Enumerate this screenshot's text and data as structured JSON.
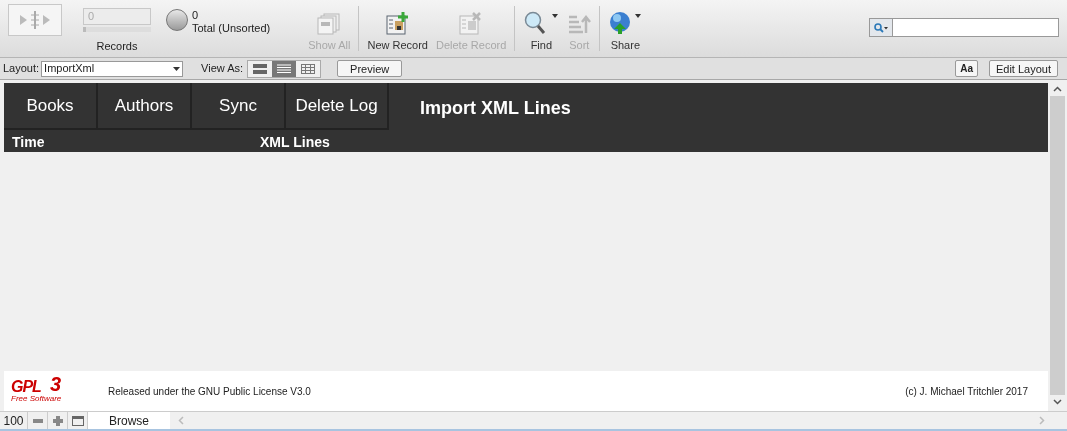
{
  "toolbar": {
    "record_field": {
      "value": "0"
    },
    "record_slider": {
      "level": 0
    },
    "records_label": "Records",
    "found_count": "0",
    "sort_status": "Total (Unsorted)",
    "buttons": [
      {
        "kind": "show_all",
        "label": "Show All",
        "disabled": true,
        "dropdown": false
      },
      {
        "kind": "separator"
      },
      {
        "kind": "new_record",
        "label": "New Record",
        "disabled": false,
        "dropdown": false
      },
      {
        "kind": "delete_record",
        "label": "Delete Record",
        "disabled": true,
        "dropdown": false
      },
      {
        "kind": "separator"
      },
      {
        "kind": "find",
        "label": "Find",
        "disabled": false,
        "dropdown": true
      },
      {
        "kind": "sort",
        "label": "Sort",
        "disabled": true,
        "dropdown": false
      },
      {
        "kind": "separator"
      },
      {
        "kind": "share",
        "label": "Share",
        "disabled": false,
        "dropdown": true
      }
    ]
  },
  "layout_bar": {
    "layout_label": "Layout:",
    "layout_value": "ImportXml",
    "view_as_label": "View As:",
    "view_modes": [
      {
        "kind": "form",
        "selected": false
      },
      {
        "kind": "list",
        "selected": true
      },
      {
        "kind": "table",
        "selected": false
      }
    ],
    "preview_button": "Preview",
    "font_button": "Aa",
    "edit_layout_button": "Edit Layout"
  },
  "nav_tabs": [
    {
      "label": "Books"
    },
    {
      "label": "Authors"
    },
    {
      "label": "Sync"
    },
    {
      "label": "Delete Log"
    }
  ],
  "page_title": "Import XML Lines",
  "table": {
    "columns": [
      "Time",
      "XML Lines"
    ]
  },
  "footer": {
    "logo": {
      "main": "GPL",
      "version": "3",
      "tagline": "Free Software"
    },
    "license": "Released under the GNU Public License V3.0",
    "copyright": "(c) J. Michael Tritchler 2017"
  },
  "status_bar": {
    "zoom": "100",
    "mode": "Browse"
  }
}
